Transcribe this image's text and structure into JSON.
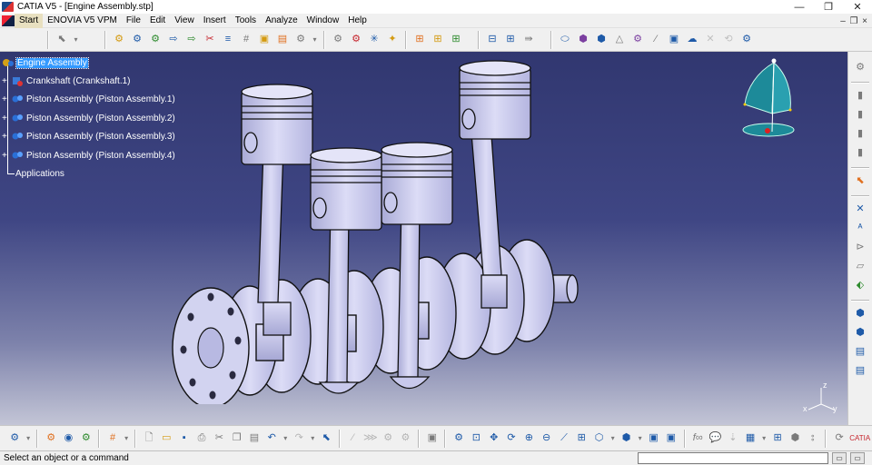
{
  "window": {
    "title": "CATIA V5 - [Engine Assembly.stp]",
    "minimize": "—",
    "restore": "❐",
    "close": "✕"
  },
  "menu": {
    "items": [
      "Start",
      "ENOVIA V5 VPM",
      "File",
      "Edit",
      "View",
      "Insert",
      "Tools",
      "Analyze",
      "Window",
      "Help"
    ],
    "doc_controls": [
      "–",
      "❐",
      "×"
    ]
  },
  "tree": {
    "root": "Engine Assembly",
    "children": [
      "Crankshaft (Crankshaft.1)",
      "Piston Assembly (Piston Assembly.1)",
      "Piston Assembly (Piston Assembly.2)",
      "Piston Assembly (Piston Assembly.3)",
      "Piston Assembly (Piston Assembly.4)"
    ],
    "applications": "Applications"
  },
  "axis": {
    "x_label": "x",
    "y_label": "y",
    "z_label": "z"
  },
  "status": {
    "message": "Select an object or a command",
    "command_value": ""
  },
  "colors": {
    "viewport_top": "#313770",
    "viewport_bottom": "#c3c5d6",
    "part_fill": "#c8c9ec",
    "selection": "#3399ff"
  },
  "brand": "CATIA"
}
